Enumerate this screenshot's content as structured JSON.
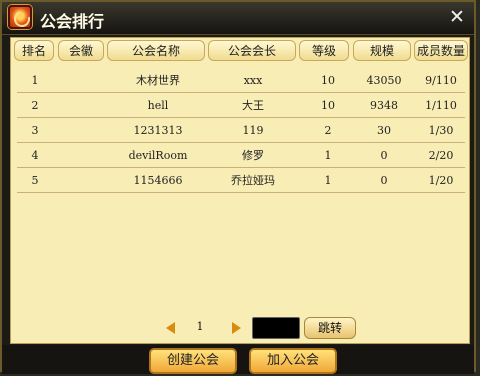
{
  "window": {
    "title": "公会排行"
  },
  "columns": [
    "排名",
    "会徽",
    "公会名称",
    "公会会长",
    "等级",
    "规模",
    "成员数量"
  ],
  "rows": [
    {
      "rank": "1",
      "name": "木材世界",
      "leader": "xxx",
      "level": "10",
      "scale": "43050",
      "members": "9/110"
    },
    {
      "rank": "2",
      "name": "hell",
      "leader": "大王",
      "level": "10",
      "scale": "9348",
      "members": "1/110"
    },
    {
      "rank": "3",
      "name": "1231313",
      "leader": "119",
      "level": "2",
      "scale": "30",
      "members": "1/30"
    },
    {
      "rank": "4",
      "name": "devilRoom",
      "leader": "修罗",
      "level": "1",
      "scale": "0",
      "members": "2/20"
    },
    {
      "rank": "5",
      "name": "1154666",
      "leader": "乔拉娅玛",
      "level": "1",
      "scale": "0",
      "members": "1/20"
    }
  ],
  "pager": {
    "current_page": "1",
    "jump_label": "跳转"
  },
  "buttons": {
    "create_label": "创建公会",
    "join_label": "加入公会"
  },
  "icons": {
    "close": "close-icon",
    "logo": "guild-logo-icon",
    "prev": "prev-page-icon",
    "next": "next-page-icon"
  }
}
